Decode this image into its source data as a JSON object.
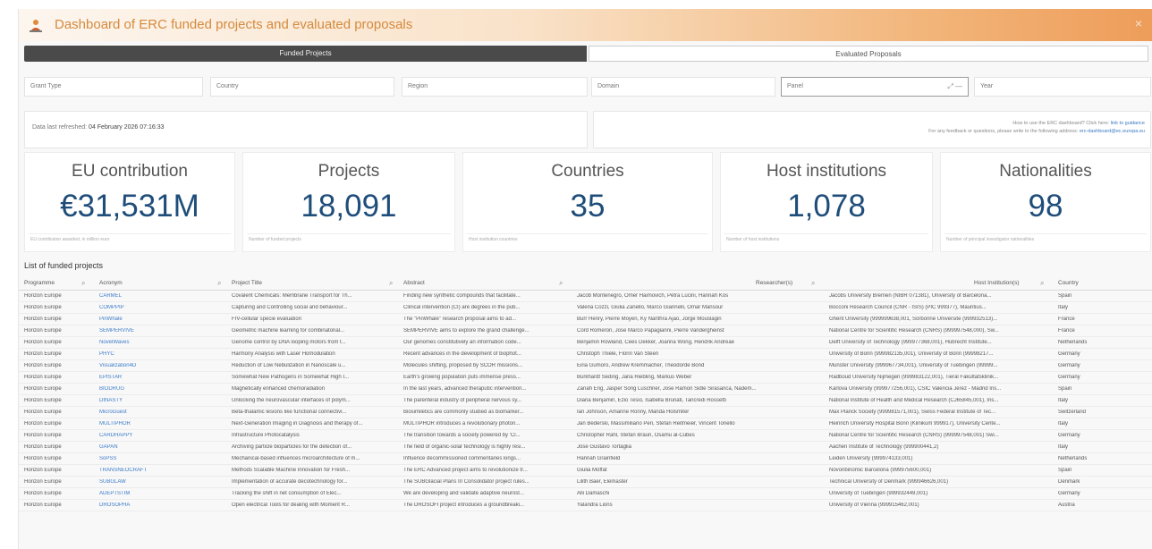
{
  "app": {
    "title": "Dashboard of ERC funded projects and evaluated proposals",
    "close_label": "×"
  },
  "tabs": [
    {
      "label": "Funded Projects",
      "active": true
    },
    {
      "label": "Evaluated Proposals",
      "active": false
    }
  ],
  "filters": [
    {
      "label": "Grant Type"
    },
    {
      "label": "Country"
    },
    {
      "label": "Region"
    },
    {
      "label": "Domain"
    },
    {
      "label": "Panel"
    },
    {
      "label": "Year"
    }
  ],
  "info": {
    "timestamp_label": "Data last refreshed:",
    "timestamp_value": "04 February 2026 07:16:33",
    "note_line1": "How to use the ERC dashboard? Click here:",
    "note_link1": "link to guidance",
    "note_line2": "For any feedback or questions, please write to the following address:",
    "note_link2": "erc-dashboard@ec.europa.eu"
  },
  "kpis": [
    {
      "label": "EU contribution",
      "value": "€31,531M",
      "foot": "EU contribution awarded, in million euro"
    },
    {
      "label": "Projects",
      "value": "18,091",
      "foot": "Number of funded projects"
    },
    {
      "label": "Countries",
      "value": "35",
      "foot": "Host institution countries"
    },
    {
      "label": "Host institutions",
      "value": "1,078",
      "foot": "Number of host institutions"
    },
    {
      "label": "Nationalities",
      "value": "98",
      "foot": "Number of principal investigator nationalities"
    }
  ],
  "table": {
    "title": "List of funded projects",
    "columns": [
      "Programme",
      "Acronym",
      "Project Title",
      "Abstract",
      "Researcher(s)",
      "Host Institution(s)",
      "Country"
    ],
    "rows": [
      {
        "programme": "Horizon Europe",
        "acronym": "CARMEL",
        "title": "Covalent Chemicals: Membrane Transport for Th...",
        "abstract": "Finding new synthetic compounds that facilitate...",
        "researchers": "Jacob Montenegro, Omer Haimovich, Petra Lucini, Hannah Kos",
        "institutions": "Jacobs University Bremen (NIBR 071381), University of Barcelona...",
        "country": "Spain"
      },
      {
        "programme": "Horizon Europe",
        "acronym": "COMPPIP",
        "title": "Capturing and Controlling social and behaviour...",
        "abstract": "Clinical intervention (CI) are degrees in the pub...",
        "researchers": "Valeria Cozzi, Giulia Zanello, Marco Giannelli, Omar Mansour",
        "institutions": "Bocconi Research Council (CNR - ISIS) (PIC 999377), Mauritius...",
        "country": "Italy"
      },
      {
        "programme": "Horizon Europe",
        "acronym": "PinWhale",
        "title": "FIV-cellular specie evaluation",
        "abstract": "The \"PinWhale\" research proposal aims to ad...",
        "researchers": "Burr Henry, Pierre Moyen, Ky Nanthra Ajao, Jorge Mouslagin",
        "institutions": "Ghent University (999999638,001, Sorbonne Universite (999932513)...",
        "country": "France"
      },
      {
        "programme": "Horizon Europe",
        "acronym": "SEMPERVIVE",
        "title": "Geometric machine learning for combinatorial...",
        "abstract": "SEMPERVIVE aims to explore the grand challenge...",
        "researchers": "Cord Romeron, Jose Marco Papagianni, Pierre Vandergheinst",
        "institutions": "National Centre for Scientific Research (CNRS) (999997548,000), Sw...",
        "country": "France"
      },
      {
        "programme": "Horizon Europe",
        "acronym": "NovelWaves",
        "title": "Genome control by DNA looping motors from t...",
        "abstract": "Our genomes constitutively an information code...",
        "researchers": "Benjamin Rowland, Cees Dekker, Joanna Wong, Hendrik Andreae",
        "institutions": "Delft University of Technology (999977368,001), Hubrecht Institute...",
        "country": "Netherlands"
      },
      {
        "programme": "Horizon Europe",
        "acronym": "PHYC",
        "title": "Harmony Analysis with Laser Homodulation",
        "abstract": "Recent advances in the development of biophot...",
        "researchers": "Christoph Thiele, Florin Van Steen",
        "institutions": "University of Bonn (999982135,001), University of Bonn (99998217...",
        "country": "Germany"
      },
      {
        "programme": "Horizon Europe",
        "acronym": "Visualization4D",
        "title": "Reduction of Low Nebulization in Nanoscale u...",
        "abstract": "Molecules shifting, proposed by SCOR missions...",
        "researchers": "Eiria Gumoro, Andrew Kremmacher, Theodorde Bond",
        "institutions": "Munster University (999967734,001), University of Tuebingen (99999...",
        "country": "Germany"
      },
      {
        "programme": "Horizon Europe",
        "acronym": "EPISTAR",
        "title": "Somewhat New Pathogens in Somewhat High I...",
        "abstract": "Earth's growing population puts immense press...",
        "researchers": "Burkhardt Seding, Jana Riebling, Markus Weber",
        "institutions": "Radboud University Nijmegen (999983122,001), Tieral Fakultatsklinik...",
        "country": "Germany"
      },
      {
        "programme": "Horizon Europe",
        "acronym": "BIODRUG",
        "title": "Magnetically enhanced chemoradiation",
        "abstract": "In the last years, advanced theraputic intervention...",
        "researchers": "Zanah Eng, Jasper Song Luschner, Jose Ramon Sidle Sirasanca, Nadem...",
        "institutions": "Karlova University (999977256,001), CSIC Valencia Jerez - Madrid Ins...",
        "country": "Spain"
      },
      {
        "programme": "Horizon Europe",
        "acronym": "DINASTY",
        "title": "Unlocking the neurovascular interfaces of polym...",
        "abstract": "The parenteral industry of peripheral nervous sy...",
        "researchers": "Diana Benjamin, Ezio Tesio, Isabella Brunati, Tancredi Rossetti",
        "institutions": "National Institute of Health and Medical Research (CJ65845,001), Ins...",
        "country": "Italy"
      },
      {
        "programme": "Horizon Europe",
        "acronym": "MicroGuest",
        "title": "Beta-thalamic lesions like functional connectivi...",
        "abstract": "Biosimiletics are commonly studied as biomarker...",
        "researchers": "Ian Johnson, Amanne Ronny, Manda Holsmiter",
        "institutions": "Max Planck Society (999981571,001), Swiss Federal Institute of Tec...",
        "country": "Switzerland"
      },
      {
        "programme": "Horizon Europe",
        "acronym": "MULTIPHOR",
        "title": "Next-Generation Imaging in Diagnosis and therapy of...",
        "abstract": "MULTIPHOR introduces a revolutionary photon...",
        "researchers": "Jan Bederski, Massimiliano Peri, Stefan Reitmeier, Vincent Tonello",
        "institutions": "Heinrich University Hospital Bonn (Klinikum 999917), University Cente...",
        "country": "Italy"
      },
      {
        "programme": "Horizon Europe",
        "acronym": "CARDHAPPY",
        "title": "Infrastructure Photocatalysis",
        "abstract": "The transition towards a society powered by 'Cl...",
        "researchers": "Christopher Rahl, Stefan Braun, Osamu al-Cubes",
        "institutions": "National Centre for Scientific Research (CNRS) (999997548,001) Swi...",
        "country": "Germany"
      },
      {
        "programme": "Horizon Europe",
        "acronym": "GAPAN",
        "title": "Archiving particle bioparticles for the detection of...",
        "abstract": "The field of organic-solar technology is highly resi...",
        "researchers": "Jose Gustavo Tortaglia",
        "institutions": "Aachen Institute of Technology (999900441,2)",
        "country": "Italy"
      },
      {
        "programme": "Horizon Europe",
        "acronym": "SoPSS",
        "title": "Mechanical-based influences microarchitecture of m...",
        "abstract": "Influence decommissioned commentaries kings...",
        "researchers": "Hannah Grainfield",
        "institutions": "Leiden University (999974133,001)",
        "country": "Netherlands"
      },
      {
        "programme": "Horizon Europe",
        "acronym": "TRANSNEOCRAFT",
        "title": "Methods Scalable Machine Innovation for Fresh...",
        "abstract": "The ERC Advanced project aims to revolutionize tr...",
        "researchers": "Giulia Moffat",
        "institutions": "Novonbinomic Barcelona (999975600,001)",
        "country": "Spain"
      },
      {
        "programme": "Horizon Europe",
        "acronym": "SUBGLAW",
        "title": "Implementation of accurate decotechnology for...",
        "abstract": "The SUBGlacial Plans III Consolidator project rules...",
        "researchers": "Lilith Baer, Elemaster",
        "institutions": "Technical University of Denmark (999946626,001)",
        "country": "Denmark"
      },
      {
        "programme": "Horizon Europe",
        "acronym": "ADEPTSTIM",
        "title": "Tracking the shift in net consumption of Elec...",
        "abstract": "We are developing and validate adaptive neurost...",
        "researchers": "Alli Damaschi",
        "institutions": "University of Tuebingen (999932449,001)",
        "country": "Germany"
      },
      {
        "programme": "Horizon Europe",
        "acronym": "DROSOPHA",
        "title": "Open electrical Tools for dealing with Moment R...",
        "abstract": "The DROSOFI project introduces a groundbreaki...",
        "researchers": "Yalandra Lions",
        "institutions": "University of Vienna (999915462,001)",
        "country": "Austria"
      }
    ]
  },
  "colors": {
    "accent": "#1f4d7a",
    "link": "#3d7cc9",
    "title_orange": "#d58a3d",
    "tab_active": "#4a4a4a"
  },
  "icons": [
    "erc-logo-icon",
    "search-icon",
    "close-icon",
    "clear-selection-icon",
    "dropdown-icon"
  ]
}
